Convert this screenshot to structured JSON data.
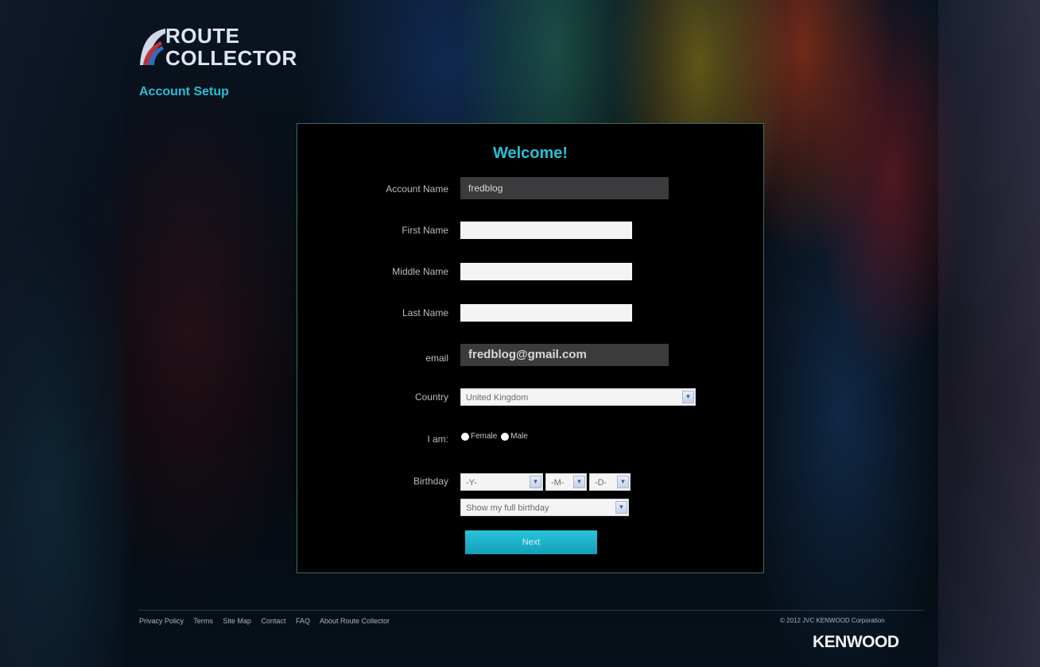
{
  "brand": {
    "logo_line1": "ROUTE",
    "logo_line2": "COLLECTOR",
    "page_subtitle": "Account Setup",
    "accent_color": "#25c0d8"
  },
  "form": {
    "heading": "Welcome!",
    "account_name": {
      "label": "Account Name",
      "value": "fredblog"
    },
    "first_name": {
      "label": "First Name",
      "value": ""
    },
    "middle_name": {
      "label": "Middle Name",
      "value": ""
    },
    "last_name": {
      "label": "Last Name",
      "value": ""
    },
    "email": {
      "label": "email",
      "value": "fredblog@gmail.com"
    },
    "country": {
      "label": "Country",
      "value": "United Kingdom"
    },
    "gender": {
      "label": "I am:",
      "options": [
        "Female",
        "Male"
      ]
    },
    "birthday": {
      "label": "Birthday",
      "year": "-Y-",
      "month": "-M-",
      "day": "-D-",
      "visibility": "Show my full birthday"
    },
    "next_label": "Next"
  },
  "footer": {
    "links": [
      "Privacy Policy",
      "Terms",
      "Site Map",
      "Contact",
      "FAQ",
      "About Route Collector"
    ],
    "copyright": "© 2012 JVC KENWOOD Corporation",
    "company_logo": "KENWOOD"
  }
}
